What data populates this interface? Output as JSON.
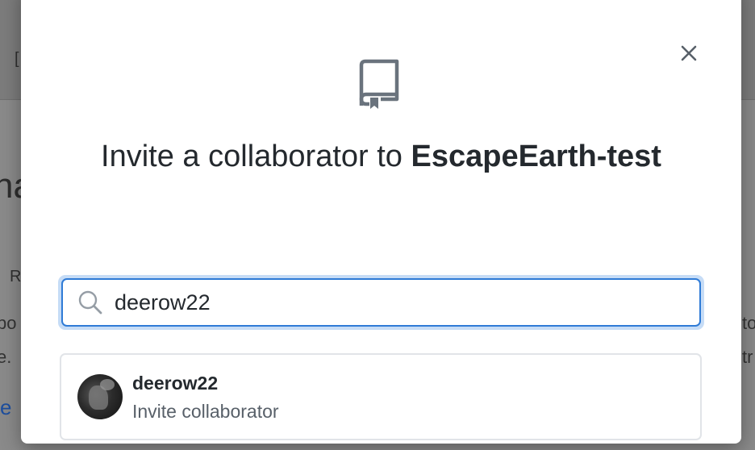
{
  "background": {
    "fragments": [
      "[",
      "na",
      "R",
      "po",
      "e.",
      "e",
      "to",
      "tr"
    ]
  },
  "modal": {
    "title_prefix": "Invite a collaborator to ",
    "repo_name": "EscapeEarth-test",
    "search": {
      "value": "deerow22",
      "placeholder": ""
    },
    "result": {
      "username": "deerow22",
      "action_label": "Invite collaborator"
    },
    "icons": {
      "close": "close-icon",
      "repo": "repo-icon",
      "search": "search-icon"
    }
  },
  "colors": {
    "focus_border": "#2f7bd6",
    "focus_ring": "#c6dcf6",
    "text_primary": "#24292e",
    "text_secondary": "#586069"
  }
}
